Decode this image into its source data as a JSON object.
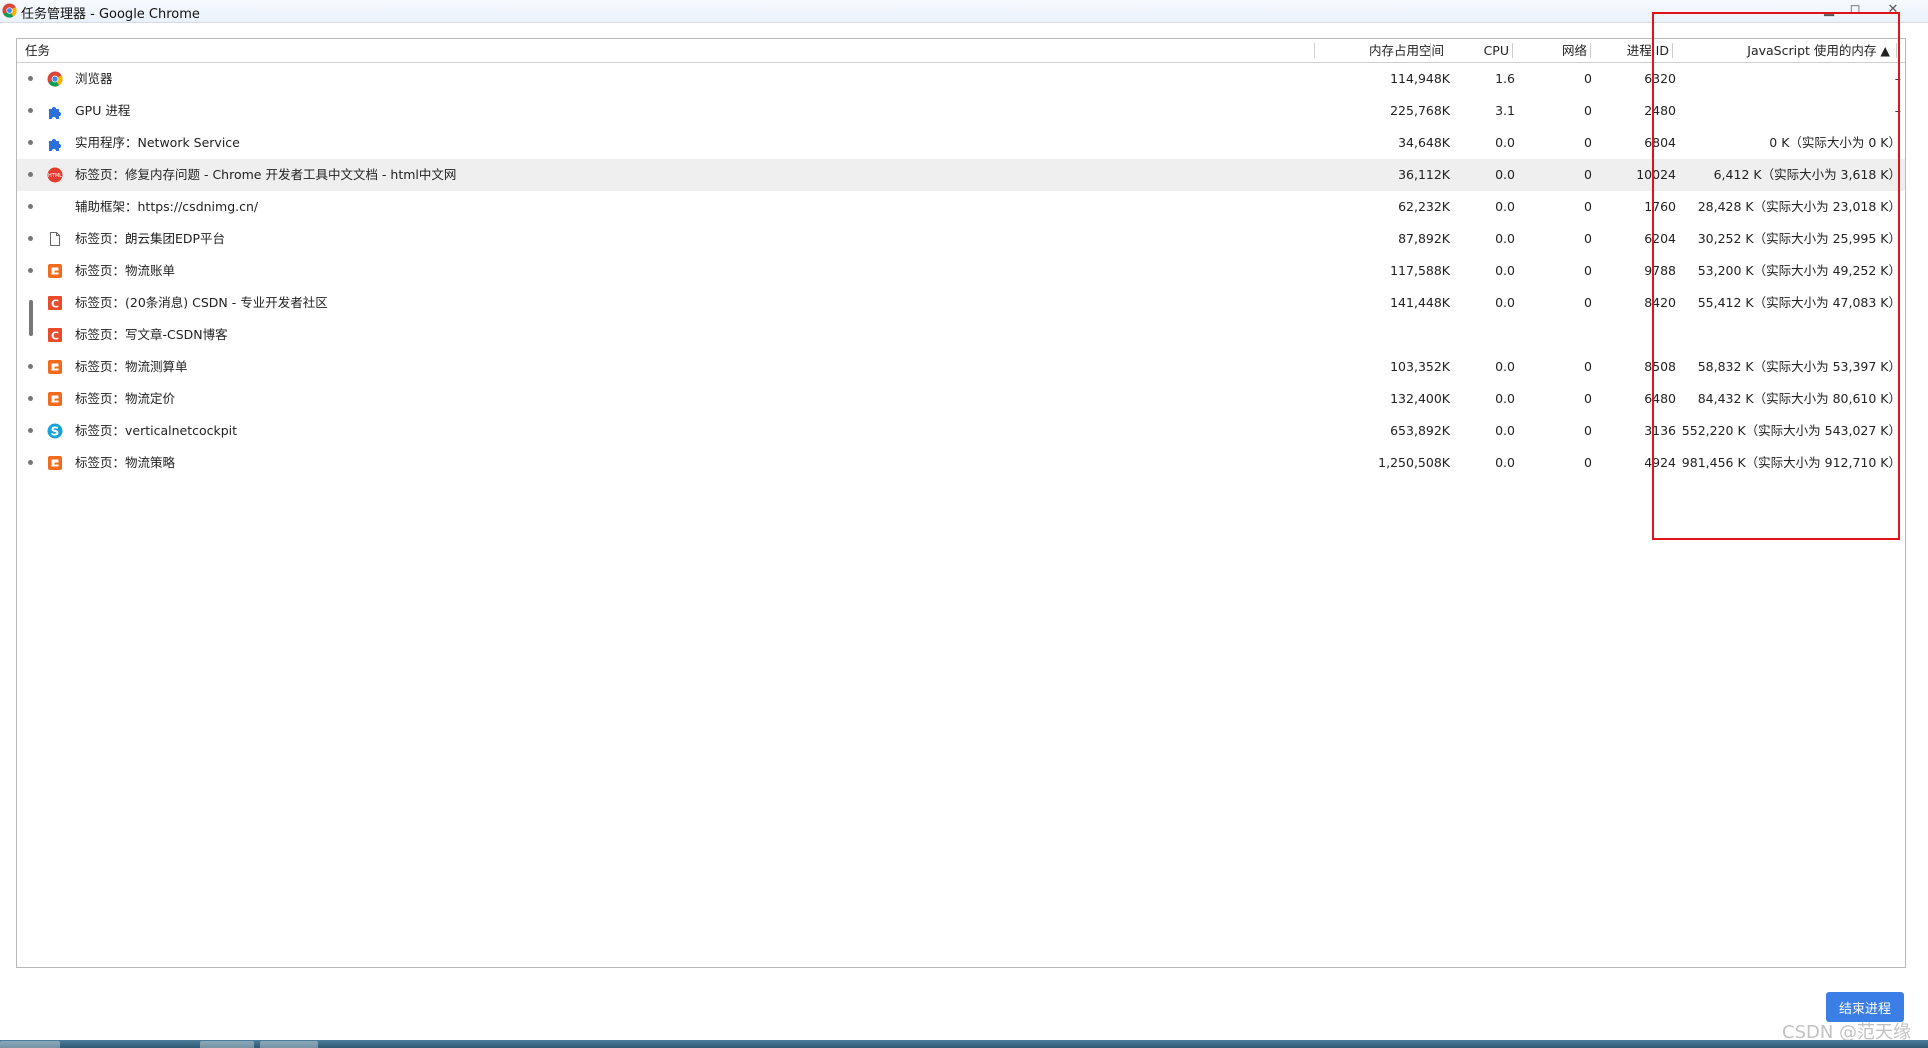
{
  "window": {
    "title": "任务管理器 - Google Chrome"
  },
  "columns": {
    "task": "任务",
    "memory": "内存占用空间",
    "cpu": "CPU",
    "network": "网络",
    "pid": "进程 ID",
    "js_memory": "JavaScript 使用的内存 ▲"
  },
  "rows": [
    {
      "task": "浏览器",
      "memory": "114,948K",
      "cpu": "1.6",
      "network": "0",
      "pid": "6320",
      "js_memory": "–",
      "icon": "chrome-icon"
    },
    {
      "task": "GPU 进程",
      "memory": "225,768K",
      "cpu": "3.1",
      "network": "0",
      "pid": "2480",
      "js_memory": "–",
      "icon": "puzzle-icon"
    },
    {
      "task": "实用程序：Network Service",
      "memory": "34,648K",
      "cpu": "0.0",
      "network": "0",
      "pid": "6804",
      "js_memory": "0 K（实际大小为 0 K）",
      "icon": "puzzle-icon"
    },
    {
      "task": "标签页：修复内存问题 - Chrome 开发者工具中文文档 - html中文网",
      "memory": "36,112K",
      "cpu": "0.0",
      "network": "0",
      "pid": "10024",
      "js_memory": "6,412 K（实际大小为 3,618 K）",
      "icon": "html-icon"
    },
    {
      "task": "辅助框架：https://csdnimg.cn/",
      "memory": "62,232K",
      "cpu": "0.0",
      "network": "0",
      "pid": "1760",
      "js_memory": "28,428 K（实际大小为 23,018 K）",
      "icon": "none"
    },
    {
      "task": "标签页：朗云集团EDP平台",
      "memory": "87,892K",
      "cpu": "0.0",
      "network": "0",
      "pid": "6204",
      "js_memory": "30,252 K（实际大小为 25,995 K）",
      "icon": "page-icon"
    },
    {
      "task": "标签页：物流账单",
      "memory": "117,588K",
      "cpu": "0.0",
      "network": "0",
      "pid": "9788",
      "js_memory": "53,200 K（实际大小为 49,252 K）",
      "icon": "logo-icon"
    },
    {
      "task": "标签页：(20条消息) CSDN - 专业开发者社区",
      "memory": "141,448K",
      "cpu": "0.0",
      "network": "0",
      "pid": "8420",
      "js_memory": "55,412 K（实际大小为 47,083 K）",
      "icon": "csdn-icon"
    },
    {
      "task": "标签页：写文章-CSDN博客",
      "memory": "",
      "cpu": "",
      "network": "",
      "pid": "",
      "js_memory": "",
      "icon": "csdn-icon"
    },
    {
      "task": "标签页：物流测算单",
      "memory": "103,352K",
      "cpu": "0.0",
      "network": "0",
      "pid": "8508",
      "js_memory": "58,832 K（实际大小为 53,397 K）",
      "icon": "logo-icon"
    },
    {
      "task": "标签页：物流定价",
      "memory": "132,400K",
      "cpu": "0.0",
      "network": "0",
      "pid": "6480",
      "js_memory": "84,432 K（实际大小为 80,610 K）",
      "icon": "logo-icon"
    },
    {
      "task": "标签页：verticalnetcockpit",
      "memory": "653,892K",
      "cpu": "0.0",
      "network": "0",
      "pid": "3136",
      "js_memory": "552,220 K（实际大小为 543,027 K）",
      "icon": "s-icon"
    },
    {
      "task": "标签页：物流策略",
      "memory": "1,250,508K",
      "cpu": "0.0",
      "network": "0",
      "pid": "4924",
      "js_memory": "981,456 K（实际大小为 912,710 K）",
      "icon": "logo-icon"
    }
  ],
  "footer": {
    "end_process": "结束进程",
    "watermark": "CSDN @范天缘"
  },
  "colors": {
    "accent_button": "#3b7ee6",
    "annotation_box": "#e0131b"
  }
}
